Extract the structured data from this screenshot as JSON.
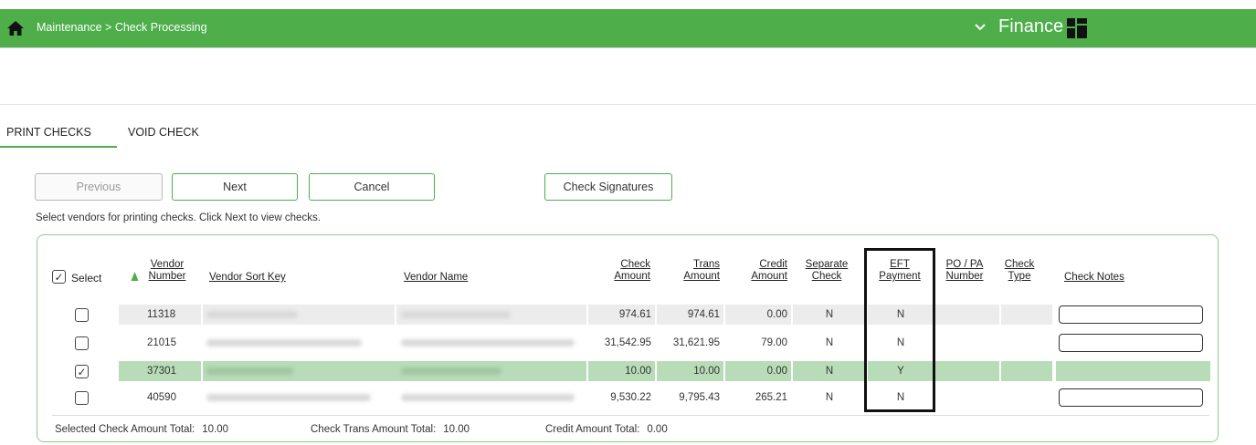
{
  "header": {
    "breadcrumb": "Maintenance > Check Processing",
    "module": "Finance",
    "home_icon": "home-icon",
    "chevron_icon": "chevron-down-icon",
    "grid_icon": "grid-menu-icon",
    "accent_color": "#4dae4a"
  },
  "tabs": [
    {
      "label": "PRINT CHECKS",
      "active": true
    },
    {
      "label": "VOID CHECK",
      "active": false
    }
  ],
  "buttons": {
    "previous": "Previous",
    "next": "Next",
    "cancel": "Cancel",
    "check_signatures": "Check Signatures"
  },
  "instruction": "Select vendors for printing checks. Click Next to view checks.",
  "table": {
    "select_label": "Select",
    "columns": {
      "vendor_number": [
        "Vendor",
        "Number"
      ],
      "vendor_sort_key": "Vendor Sort Key",
      "vendor_name": "Vendor Name",
      "check_amount": [
        "Check",
        "Amount"
      ],
      "trans_amount": [
        "Trans",
        "Amount"
      ],
      "credit_amount": [
        "Credit",
        "Amount"
      ],
      "separate_check": [
        "Separate",
        "Check"
      ],
      "eft_payment": [
        "EFT",
        "Payment"
      ],
      "po_pa_number": [
        "PO / PA",
        "Number"
      ],
      "check_type": [
        "Check",
        "Type"
      ],
      "check_notes": "Check Notes"
    },
    "rows": [
      {
        "selected": false,
        "vendor_number": "11318",
        "check_amount": "974.61",
        "trans_amount": "974.61",
        "credit_amount": "0.00",
        "separate_check": "N",
        "eft_payment": "N"
      },
      {
        "selected": false,
        "vendor_number": "21015",
        "check_amount": "31,542.95",
        "trans_amount": "31,621.95",
        "credit_amount": "79.00",
        "separate_check": "N",
        "eft_payment": "N"
      },
      {
        "selected": true,
        "vendor_number": "37301",
        "check_amount": "10.00",
        "trans_amount": "10.00",
        "credit_amount": "0.00",
        "separate_check": "N",
        "eft_payment": "Y"
      },
      {
        "selected": false,
        "vendor_number": "40590",
        "check_amount": "9,530.22",
        "trans_amount": "9,795.43",
        "credit_amount": "265.21",
        "separate_check": "N",
        "eft_payment": "N"
      }
    ]
  },
  "totals": {
    "selected_check_label": "Selected Check Amount Total:",
    "selected_check_value": "10.00",
    "check_trans_label": "Check Trans Amount Total:",
    "check_trans_value": "10.00",
    "credit_label": "Credit Amount Total:",
    "credit_value": "0.00"
  }
}
